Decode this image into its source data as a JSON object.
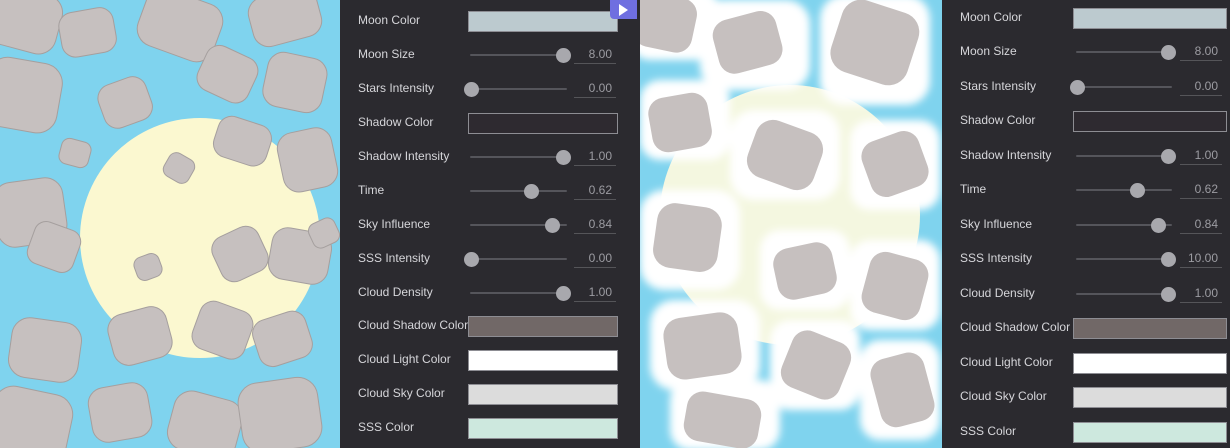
{
  "panels": [
    {
      "rows": [
        {
          "label": "Moon Color",
          "kind": "color",
          "color": "#bccacf"
        },
        {
          "label": "Moon Size",
          "kind": "slider",
          "value": "8.00",
          "fraction": 0.95
        },
        {
          "label": "Stars Intensity",
          "kind": "slider",
          "value": "0.00",
          "fraction": 0.0
        },
        {
          "label": "Shadow Color",
          "kind": "color",
          "color": "#2e2a30"
        },
        {
          "label": "Shadow Intensity",
          "kind": "slider",
          "value": "1.00",
          "fraction": 0.95
        },
        {
          "label": "Time",
          "kind": "slider",
          "value": "0.62",
          "fraction": 0.62
        },
        {
          "label": "Sky Influence",
          "kind": "slider",
          "value": "0.84",
          "fraction": 0.84
        },
        {
          "label": "SSS Intensity",
          "kind": "slider",
          "value": "0.00",
          "fraction": 0.0
        },
        {
          "label": "Cloud Density",
          "kind": "slider",
          "value": "1.00",
          "fraction": 0.95
        },
        {
          "label": "Cloud Shadow Color",
          "kind": "color",
          "color": "#716867"
        },
        {
          "label": "Cloud Light Color",
          "kind": "color",
          "color": "#ffffff"
        },
        {
          "label": "Cloud Sky Color",
          "kind": "color",
          "color": "#dcdcdc"
        },
        {
          "label": "SSS Color",
          "kind": "color",
          "color": "#cde8de"
        }
      ]
    },
    {
      "rows": [
        {
          "label": "Moon Color",
          "kind": "color",
          "color": "#bccacf"
        },
        {
          "label": "Moon Size",
          "kind": "slider",
          "value": "8.00",
          "fraction": 0.95
        },
        {
          "label": "Stars Intensity",
          "kind": "slider",
          "value": "0.00",
          "fraction": 0.0
        },
        {
          "label": "Shadow Color",
          "kind": "color",
          "color": "#2e2a30"
        },
        {
          "label": "Shadow Intensity",
          "kind": "slider",
          "value": "1.00",
          "fraction": 0.95
        },
        {
          "label": "Time",
          "kind": "slider",
          "value": "0.62",
          "fraction": 0.62
        },
        {
          "label": "Sky Influence",
          "kind": "slider",
          "value": "0.84",
          "fraction": 0.84
        },
        {
          "label": "SSS Intensity",
          "kind": "slider",
          "value": "10.00",
          "fraction": 0.95
        },
        {
          "label": "Cloud Density",
          "kind": "slider",
          "value": "1.00",
          "fraction": 0.95
        },
        {
          "label": "Cloud Shadow Color",
          "kind": "color",
          "color": "#716867"
        },
        {
          "label": "Cloud Light Color",
          "kind": "color",
          "color": "#ffffff"
        },
        {
          "label": "Cloud Sky Color",
          "kind": "color",
          "color": "#dcdcdc"
        },
        {
          "label": "SSS Color",
          "kind": "color",
          "color": "#cde8de"
        }
      ]
    }
  ],
  "play_button": {
    "icon": "play-icon",
    "color": "#6f6fe0"
  },
  "scene": {
    "sky_color": "#7fd3ee",
    "moon_color": "#fbf8d0",
    "cloud_color": "#c6c0bf"
  }
}
